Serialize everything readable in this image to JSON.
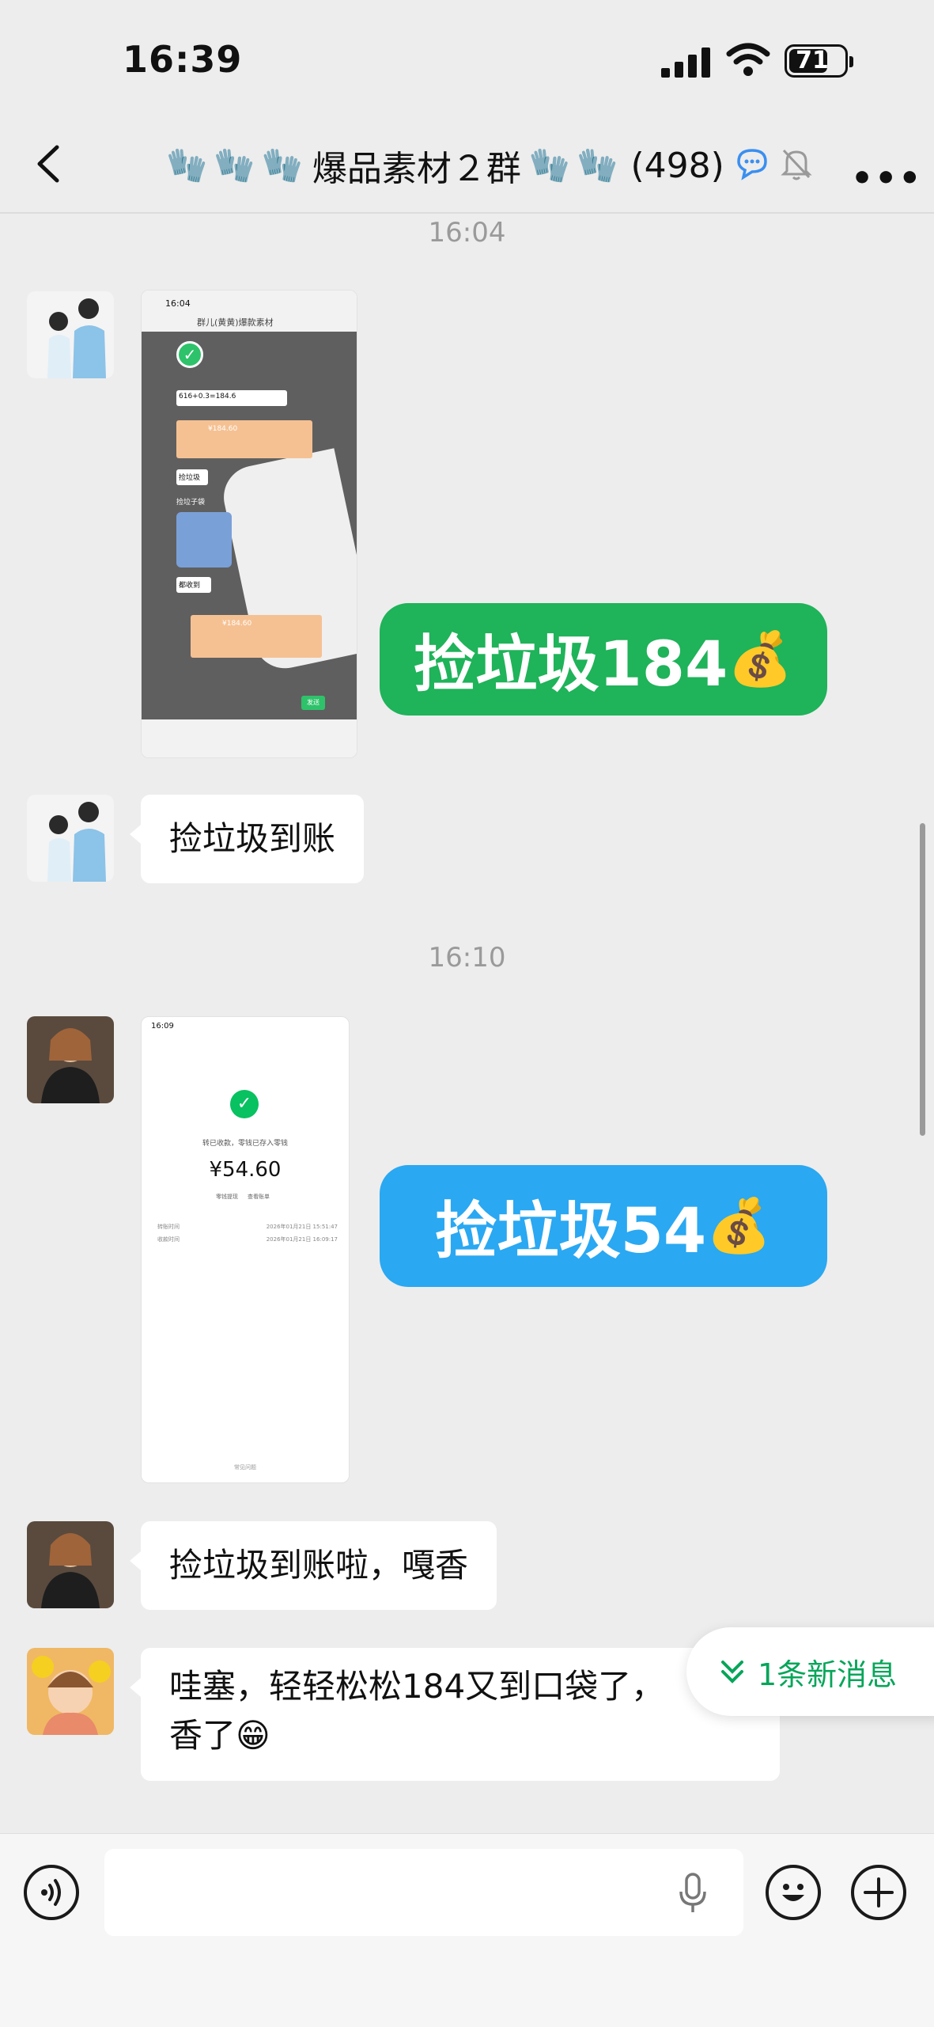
{
  "status_bar": {
    "time": "16:39",
    "battery": "71",
    "battery_level": 0.71
  },
  "nav": {
    "back_icon": "chevron-left-icon",
    "glove_icon": "🧤",
    "title": "爆品素材２群",
    "member_count": "(498)",
    "more_icon": "more-icon"
  },
  "messages": {
    "time1": "16:04",
    "sticker1": {
      "text": "捡垃圾184",
      "emoji": "💰",
      "color": "#1fb35a"
    },
    "msg1": "捡垃圾到账",
    "time2": "16:10",
    "sticker2": {
      "text": "捡垃圾54",
      "emoji": "💰",
      "color": "#2aa8f2"
    },
    "msg2": "捡垃圾到账啦，嘎香",
    "msg3_line1": "哇塞，轻轻松松184又到口袋了，",
    "msg3_line2": "香了",
    "msg3_emoji": "😁"
  },
  "screenshot1": {
    "time": "16:04",
    "title": "群儿(黄黄)爆款素材",
    "line_formula": "616+0.3=184.6",
    "text_pickup": "捡垃圾",
    "text_sticker": "捡垃子袋",
    "text_already": "都收到",
    "amount1": "¥184.60",
    "amount2": "¥184.60",
    "btn": "发送"
  },
  "screenshot2": {
    "time": "16:09",
    "status": "转已收款，零钱已存入零钱",
    "amount": "¥54.60",
    "sub1": "零钱提现",
    "sub2": "查看账单",
    "row1_label": "转账时间",
    "row1_value": "2026年01月21日 15:51:47",
    "row2_label": "收款时间",
    "row2_value": "2026年01月21日 16:09:17",
    "footer": "常见问题"
  },
  "new_messages": {
    "label": "1条新消息"
  },
  "input": {
    "voice_icon": "voice-icon",
    "mic_icon": "mic-icon",
    "emoji_icon": "emoji-icon",
    "plus_icon": "plus-icon"
  }
}
